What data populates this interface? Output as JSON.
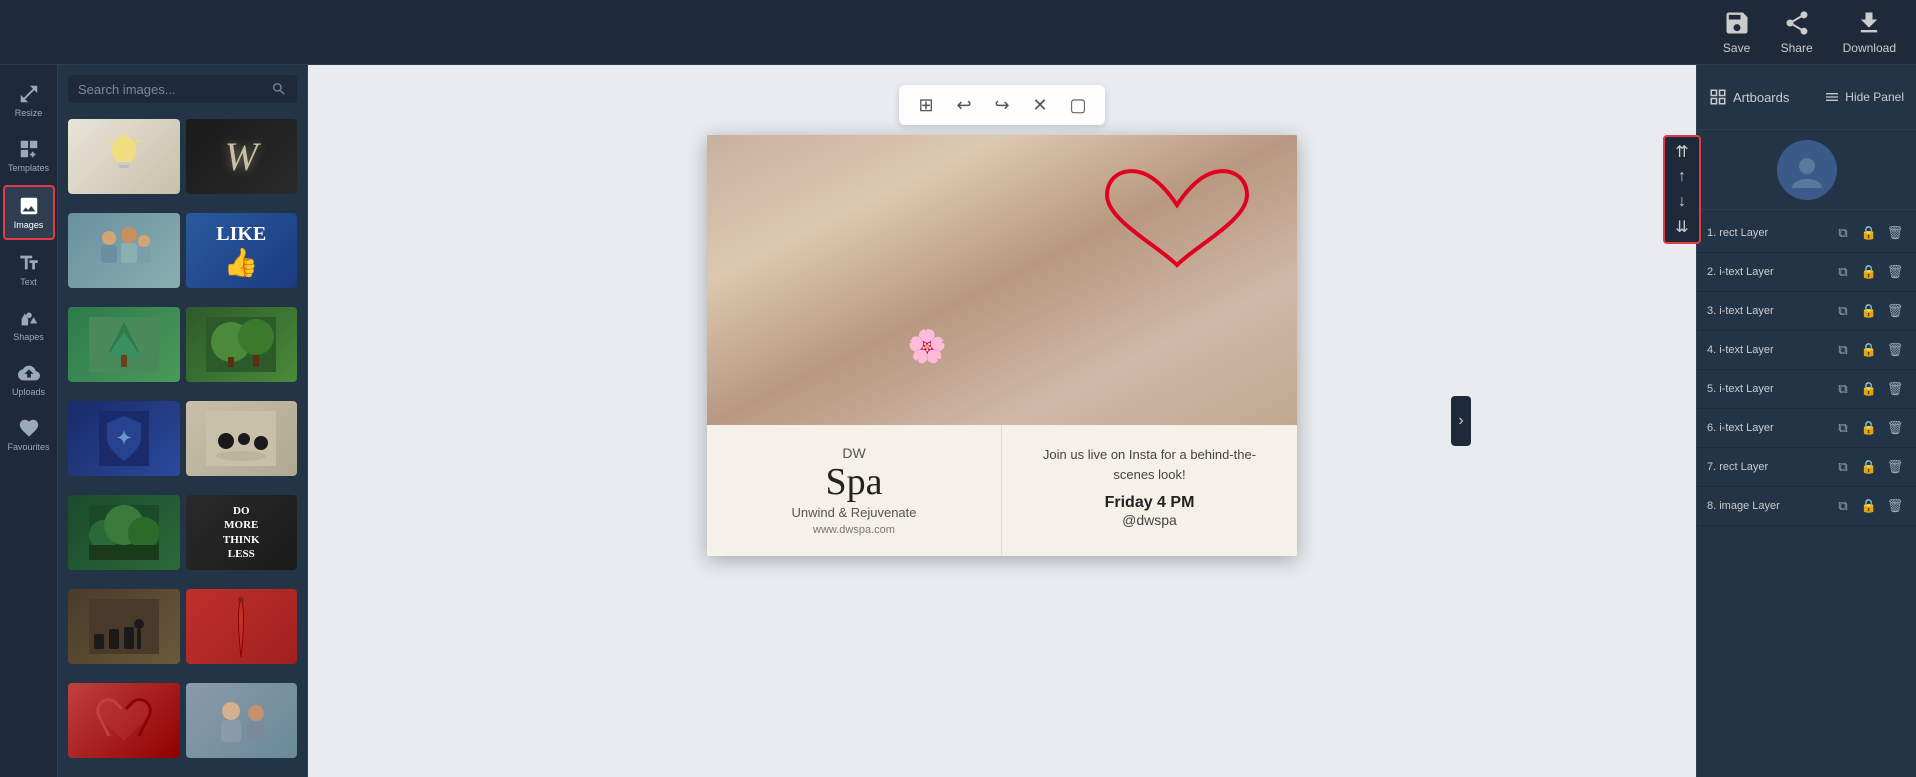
{
  "header": {
    "save_label": "Save",
    "share_label": "Share",
    "download_label": "Download"
  },
  "top_bar": {
    "artboards_label": "Artboards",
    "hide_panel_label": "Hide Panel"
  },
  "icon_sidebar": {
    "items": [
      {
        "id": "resize",
        "label": "Resize"
      },
      {
        "id": "templates",
        "label": "Templates"
      },
      {
        "id": "images",
        "label": "Images"
      },
      {
        "id": "text",
        "label": "Text"
      },
      {
        "id": "shapes",
        "label": "Shapes"
      },
      {
        "id": "uploads",
        "label": "Uploads"
      },
      {
        "id": "favourites",
        "label": "Favourites"
      }
    ]
  },
  "panel": {
    "search_placeholder": "Search images...",
    "thumbnails": [
      {
        "id": "lightbulb",
        "alt": "Light bulb"
      },
      {
        "id": "w-letter",
        "alt": "Letter W"
      },
      {
        "id": "family",
        "alt": "Family"
      },
      {
        "id": "like",
        "alt": "Like button"
      },
      {
        "id": "nature",
        "alt": "Nature"
      },
      {
        "id": "trees",
        "alt": "Trees"
      },
      {
        "id": "shield",
        "alt": "Shield"
      },
      {
        "id": "food",
        "alt": "Food"
      },
      {
        "id": "forest",
        "alt": "Forest"
      },
      {
        "id": "dothink",
        "alt": "Do More Think Less"
      },
      {
        "id": "chess",
        "alt": "Chess"
      },
      {
        "id": "red",
        "alt": "Red decoration"
      },
      {
        "id": "heart",
        "alt": "Broken heart"
      },
      {
        "id": "people",
        "alt": "People"
      }
    ]
  },
  "canvas": {
    "toolbar": {
      "grid_icon": "⊞",
      "undo_icon": "↩",
      "redo_icon": "↪",
      "close_icon": "✕",
      "frame_icon": "☐"
    },
    "design": {
      "brand": "DW",
      "spa_name": "Spa",
      "tagline": "Unwind & Rejuvenate",
      "website": "www.dwspa.com",
      "invite_text": "Join us live on Insta for a behind-the-scenes look!",
      "time": "Friday 4 PM",
      "handle": "@dwspa"
    }
  },
  "layers": {
    "order_up_top": "⇈",
    "order_up": "↑",
    "order_down": "↓",
    "order_down_bottom": "⇊",
    "items": [
      {
        "id": 1,
        "name": "1. rect Layer"
      },
      {
        "id": 2,
        "name": "2. i-text Layer"
      },
      {
        "id": 3,
        "name": "3. i-text Layer"
      },
      {
        "id": 4,
        "name": "4. i-text Layer"
      },
      {
        "id": 5,
        "name": "5. i-text Layer"
      },
      {
        "id": 6,
        "name": "6. i-text Layer"
      },
      {
        "id": 7,
        "name": "7. rect Layer"
      },
      {
        "id": 8,
        "name": "8. image Layer"
      }
    ],
    "copy_icon": "⧉",
    "lock_icon": "🔒",
    "delete_icon": "🗑"
  },
  "colors": {
    "accent_red": "#e63946",
    "bg_dark": "#1e2a3a",
    "bg_mid": "#243447",
    "panel_border": "#2e3d50"
  }
}
